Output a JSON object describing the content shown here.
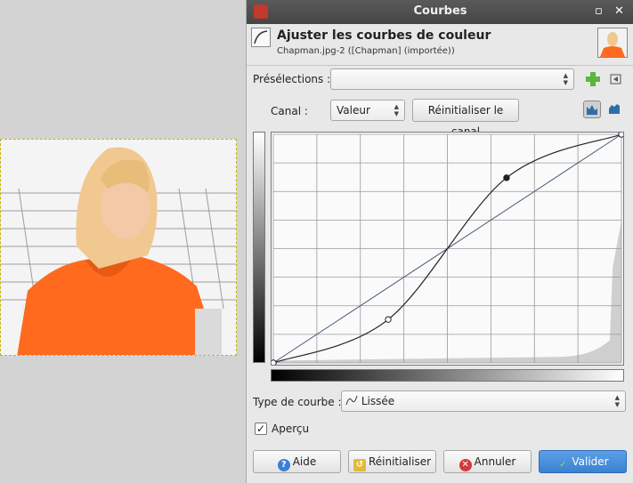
{
  "dialog": {
    "title": "Courbes",
    "window_buttons": [
      "maximize-icon",
      "close-icon"
    ]
  },
  "header": {
    "title": "Ajuster les courbes de couleur",
    "subtitle": "Chapman.jpg-2 ([Chapman] (importée))"
  },
  "presets": {
    "label": "Présélections :",
    "value": ""
  },
  "channel": {
    "label": "Canal :",
    "value": "Valeur",
    "reset_label": "Réinitialiser le canal"
  },
  "curve": {
    "control_points": [
      [
        0,
        0
      ],
      [
        0.33,
        0.19
      ],
      [
        0.67,
        0.81
      ],
      [
        1,
        1
      ]
    ],
    "grid_divisions": 8
  },
  "curve_type": {
    "label": "Type de courbe :",
    "value": "Lissée"
  },
  "preview": {
    "label": "Aperçu",
    "checked": true
  },
  "buttons": {
    "help": "Aide",
    "reset": "Réinitialiser",
    "cancel": "Annuler",
    "ok": "Valider"
  },
  "colors": {
    "accent": "#4a90d9",
    "titlebar": "#4e4e4e",
    "photo_orange": "#ff6a1f"
  }
}
